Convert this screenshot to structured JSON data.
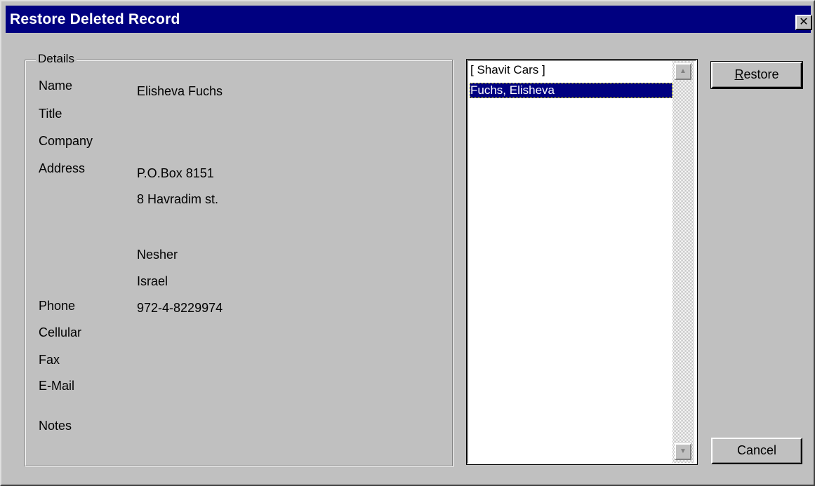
{
  "window": {
    "title": "Restore Deleted Record",
    "close_glyph": "✕"
  },
  "details": {
    "legend": "Details",
    "labels": {
      "name": "Name",
      "title": "Title",
      "company": "Company",
      "address": "Address",
      "phone": "Phone",
      "cellular": "Cellular",
      "fax": "Fax",
      "email": "E-Mail",
      "notes": "Notes"
    },
    "values": {
      "name": "Elisheva Fuchs",
      "address_line1": "P.O.Box 8151",
      "address_line2": "8 Havradim st.",
      "city": "Nesher",
      "country": "Israel",
      "phone": "972-4-8229974"
    }
  },
  "list": {
    "items": [
      {
        "label": "[ Shavit Cars ]",
        "selected": false
      },
      {
        "label": "Fuchs, Elisheva",
        "selected": true
      }
    ],
    "scroll_up_icon": "▲",
    "scroll_down_icon": "▼"
  },
  "buttons": {
    "restore_first": "R",
    "restore_rest": "estore",
    "cancel": "Cancel"
  },
  "colors": {
    "titlebar": "#000080",
    "face": "#c0c0c0",
    "selection": "#000080"
  }
}
